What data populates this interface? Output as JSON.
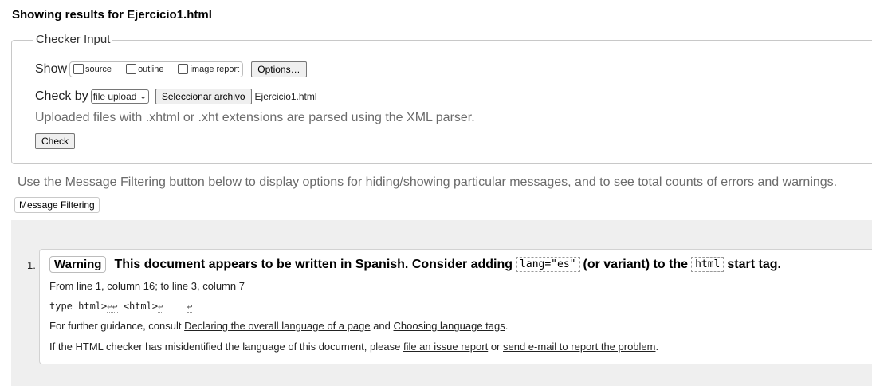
{
  "page": {
    "title": "Showing results for Ejercicio1.html"
  },
  "checker_input": {
    "legend": "Checker Input",
    "show_label": "Show",
    "show_options": [
      {
        "label": "source",
        "checked": false
      },
      {
        "label": "outline",
        "checked": false
      },
      {
        "label": "image report",
        "checked": false
      }
    ],
    "options_button": "Options…",
    "check_by_label": "Check by",
    "check_by_selected": "file upload",
    "file_button": "Seleccionar archivo",
    "file_name": "Ejercicio1.html",
    "hint": "Uploaded files with .xhtml or .xht extensions are parsed using the XML parser.",
    "check_button": "Check"
  },
  "filter": {
    "info": "Use the Message Filtering button below to display options for hiding/showing particular messages, and to see total counts of errors and warnings.",
    "button": "Message Filtering"
  },
  "messages": [
    {
      "number": "1.",
      "type": "Warning",
      "text_before": "This document appears to be written in Spanish. Consider adding",
      "code_1": "lang=\"es\"",
      "text_middle": "(or variant) to the",
      "code_2": "html",
      "text_after": "start tag.",
      "location": "From line 1, column 16; to line 3, column 7",
      "extract_prefix": "type html>",
      "extract_returns_1": "↩↩",
      "extract_middle": " <html>",
      "extract_return_2": "↩",
      "extract_return_3": "↩",
      "guidance_prefix": "For further guidance, consult",
      "guidance_link_1": "Declaring the overall language of a page",
      "guidance_and": "and",
      "guidance_link_2": "Choosing language tags",
      "guidance_end": ".",
      "report_prefix": "If the HTML checker has misidentified the language of this document, please",
      "report_link_1": "file an issue report",
      "report_or": "or",
      "report_link_2": "send e-mail to report the problem",
      "report_end": "."
    }
  ],
  "colors": {
    "results_bg": "#efefef",
    "hint_text": "#6b6b6b"
  }
}
